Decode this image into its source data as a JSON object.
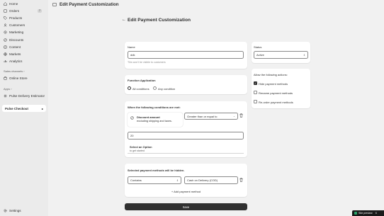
{
  "sidebar": {
    "items": [
      {
        "label": "Home",
        "icon": "home-icon"
      },
      {
        "label": "Orders",
        "icon": "orders-icon",
        "badge": "7"
      },
      {
        "label": "Products",
        "icon": "tag-icon"
      },
      {
        "label": "Customers",
        "icon": "person-icon"
      },
      {
        "label": "Marketing",
        "icon": "target-icon"
      },
      {
        "label": "Discounts",
        "icon": "discount-icon"
      },
      {
        "label": "Content",
        "icon": "content-icon"
      },
      {
        "label": "Markets",
        "icon": "globe-icon"
      },
      {
        "label": "Analytics",
        "icon": "chart-icon"
      }
    ],
    "sales_channels_label": "Sales channels",
    "sales_channels": [
      {
        "label": "Online Store",
        "icon": "store-icon"
      }
    ],
    "apps_label": "Apps",
    "apps": [
      {
        "label": "Pulse Delivery Estimator",
        "icon": "app-icon"
      }
    ],
    "active_app": "Pulse Checkout",
    "settings_label": "Settings"
  },
  "topbar": {
    "title": "Edit Payment Customization"
  },
  "page": {
    "title": "Edit Payment Customization"
  },
  "name_card": {
    "label": "Name",
    "value": "ddk",
    "help": "This won't be visible to customers"
  },
  "status_card": {
    "label": "Status",
    "value": "Active"
  },
  "apply_card": {
    "title": "Function Application",
    "options": [
      "All conditions",
      "Any condition"
    ],
    "selected": "All conditions"
  },
  "actions_card": {
    "title": "Allow the following actions:",
    "options": [
      {
        "label": "Hide payment methods",
        "checked": true
      },
      {
        "label": "Rename payment methods",
        "checked": false
      },
      {
        "label": "Re-order payment methods",
        "checked": false
      }
    ]
  },
  "conditions_card": {
    "title": "When the following conditions are met:",
    "condition_name": "Discount amount",
    "condition_desc": "excluding shipping and taxes.",
    "operator": "Greater than or equal to",
    "amount": "20",
    "option_title": "Select an Option",
    "option_sub": "to get started"
  },
  "payments_card": {
    "title": "Selected payment methods will be hidden.",
    "match": "Contains",
    "method": "Cash on Delivery (COD)",
    "add_label": "+ Add payment method"
  },
  "save_label": "Save",
  "toast": {
    "label": "Site preview",
    "close": "X"
  }
}
